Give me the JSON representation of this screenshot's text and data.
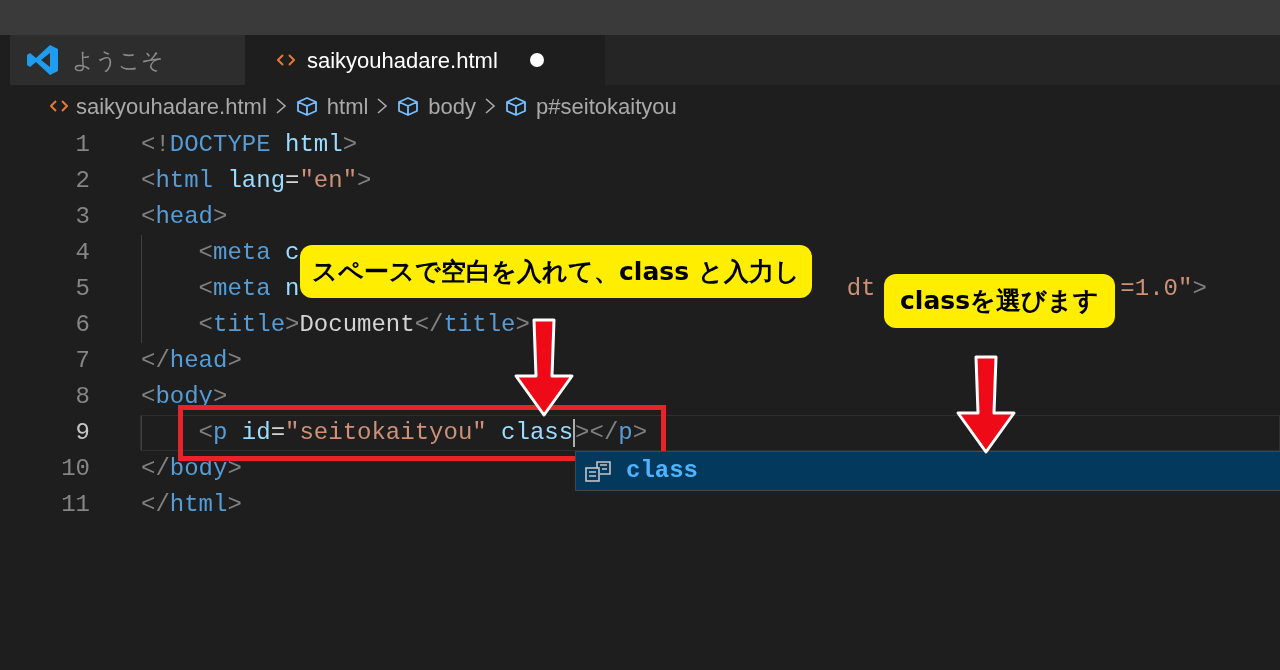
{
  "tabs": [
    {
      "label": "ようこそ",
      "kind": "welcome",
      "selected": false,
      "dirty": false
    },
    {
      "label": "saikyouhadare.html",
      "kind": "file",
      "selected": true,
      "dirty": true
    }
  ],
  "breadcrumbs": [
    {
      "label": "saikyouhadare.html",
      "kind": "file"
    },
    {
      "label": "html",
      "kind": "element"
    },
    {
      "label": "body",
      "kind": "element"
    },
    {
      "label": "p#seitokaityou",
      "kind": "element"
    }
  ],
  "lines": [
    {
      "number": "1",
      "current": false,
      "tokens": [
        {
          "kind": "bracket",
          "text": "<!"
        },
        {
          "kind": "tag",
          "text": "DOCTYPE"
        },
        {
          "kind": "attr",
          "text": " html"
        },
        {
          "kind": "bracket",
          "text": ">"
        }
      ]
    },
    {
      "number": "2",
      "current": false,
      "tokens": [
        {
          "kind": "bracket",
          "text": "<"
        },
        {
          "kind": "tag",
          "text": "html"
        },
        {
          "kind": "attr",
          "text": " lang"
        },
        {
          "kind": "text",
          "text": "="
        },
        {
          "kind": "string",
          "text": "\"en\""
        },
        {
          "kind": "bracket",
          "text": ">"
        }
      ]
    },
    {
      "number": "3",
      "current": false,
      "tokens": [
        {
          "kind": "bracket",
          "text": "<"
        },
        {
          "kind": "tag",
          "text": "head"
        },
        {
          "kind": "bracket",
          "text": ">"
        }
      ],
      "children": [
        {
          "number": "4",
          "current": false,
          "tokens": [
            {
              "kind": "bracket",
              "text": "<"
            },
            {
              "kind": "tag",
              "text": "meta"
            },
            {
              "kind": "attr",
              "text": " c"
            }
          ]
        },
        {
          "number": "5",
          "current": false,
          "tokens": [
            {
              "kind": "bracket",
              "text": "<"
            },
            {
              "kind": "tag",
              "text": "meta"
            },
            {
              "kind": "attr",
              "text": " n"
            },
            {
              "kind": "gap"
            },
            {
              "kind": "string",
              "text": "dt"
            },
            {
              "kind": "gap"
            },
            {
              "kind": "string",
              "text": "=1.0\""
            },
            {
              "kind": "bracket",
              "text": ">"
            }
          ]
        },
        {
          "number": "6",
          "current": false,
          "tokens": [
            {
              "kind": "bracket",
              "text": "<"
            },
            {
              "kind": "tag",
              "text": "title"
            },
            {
              "kind": "bracket",
              "text": ">"
            },
            {
              "kind": "text",
              "text": "Document"
            },
            {
              "kind": "bracket",
              "text": "</"
            },
            {
              "kind": "tag",
              "text": "title"
            },
            {
              "kind": "bracket",
              "text": ">"
            }
          ]
        }
      ]
    },
    {
      "number": "7",
      "current": false,
      "tokens": [
        {
          "kind": "bracket",
          "text": "</"
        },
        {
          "kind": "tag",
          "text": "head"
        },
        {
          "kind": "bracket",
          "text": ">"
        }
      ]
    },
    {
      "number": "8",
      "current": false,
      "tokens": [
        {
          "kind": "bracket",
          "text": "<"
        },
        {
          "kind": "tag",
          "text": "body"
        },
        {
          "kind": "bracket",
          "text": ">"
        }
      ],
      "children": [
        {
          "number": "9",
          "current": true,
          "tokens": [
            {
              "kind": "bracket",
              "text": "<"
            },
            {
              "kind": "tag",
              "text": "p"
            },
            {
              "kind": "attr",
              "text": " id"
            },
            {
              "kind": "text",
              "text": "="
            },
            {
              "kind": "string",
              "text": "\"seitokaityou\""
            },
            {
              "kind": "attr",
              "text": " class"
            },
            {
              "kind": "cursor"
            },
            {
              "kind": "bracket",
              "text": "></"
            },
            {
              "kind": "tag",
              "text": "p"
            },
            {
              "kind": "bracket",
              "text": ">"
            }
          ]
        }
      ]
    },
    {
      "number": "10",
      "current": false,
      "tokens": [
        {
          "kind": "bracket",
          "text": "</"
        },
        {
          "kind": "tag",
          "text": "body"
        },
        {
          "kind": "bracket",
          "text": ">"
        }
      ]
    },
    {
      "number": "11",
      "current": false,
      "tokens": [
        {
          "kind": "bracket",
          "text": "</"
        },
        {
          "kind": "tag",
          "text": "html"
        },
        {
          "kind": "bracket",
          "text": ">"
        }
      ]
    }
  ],
  "suggestions": [
    {
      "label": "class",
      "selected": true
    }
  ],
  "callouts": [
    "スペースで空白を入れて、class と入力し",
    "classを選びます"
  ]
}
